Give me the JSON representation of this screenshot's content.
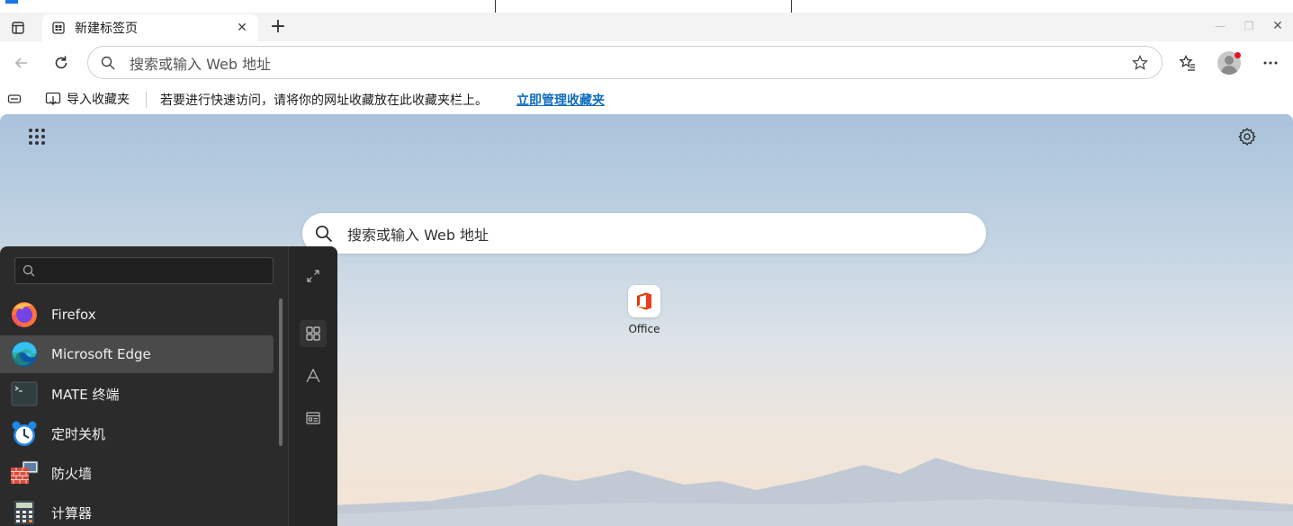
{
  "browser": {
    "tab": {
      "title": "新建标签页"
    },
    "address_bar": {
      "placeholder": "搜索或输入 Web 地址"
    },
    "favorites_bar": {
      "import_label": "导入收藏夹",
      "message": "若要进行快速访问，请将你的网址收藏放在此收藏夹栏上。",
      "manage_link": "立即管理收藏夹"
    }
  },
  "new_tab_page": {
    "search_placeholder": "搜索或输入 Web 地址",
    "tiles": [
      {
        "label": "Office",
        "icon": "office-icon"
      }
    ]
  },
  "app_menu": {
    "apps": [
      {
        "label": "Firefox",
        "icon": "firefox-icon"
      },
      {
        "label": "Microsoft Edge",
        "icon": "edge-icon",
        "selected": true
      },
      {
        "label": "MATE 终端",
        "icon": "terminal-icon"
      },
      {
        "label": "定时关机",
        "icon": "alarm-clock-icon"
      },
      {
        "label": "防火墙",
        "icon": "firewall-icon"
      },
      {
        "label": "计算器",
        "icon": "calculator-icon"
      }
    ],
    "side_buttons": [
      "expand-icon",
      "grid-view-icon",
      "alphabet-view-icon",
      "category-view-icon"
    ]
  },
  "colors": {
    "accent": "#0f6cbd",
    "menu_bg": "#2b2b2b",
    "menu_selected": "#4a4a4a",
    "avatar_badge": "#e81123"
  }
}
